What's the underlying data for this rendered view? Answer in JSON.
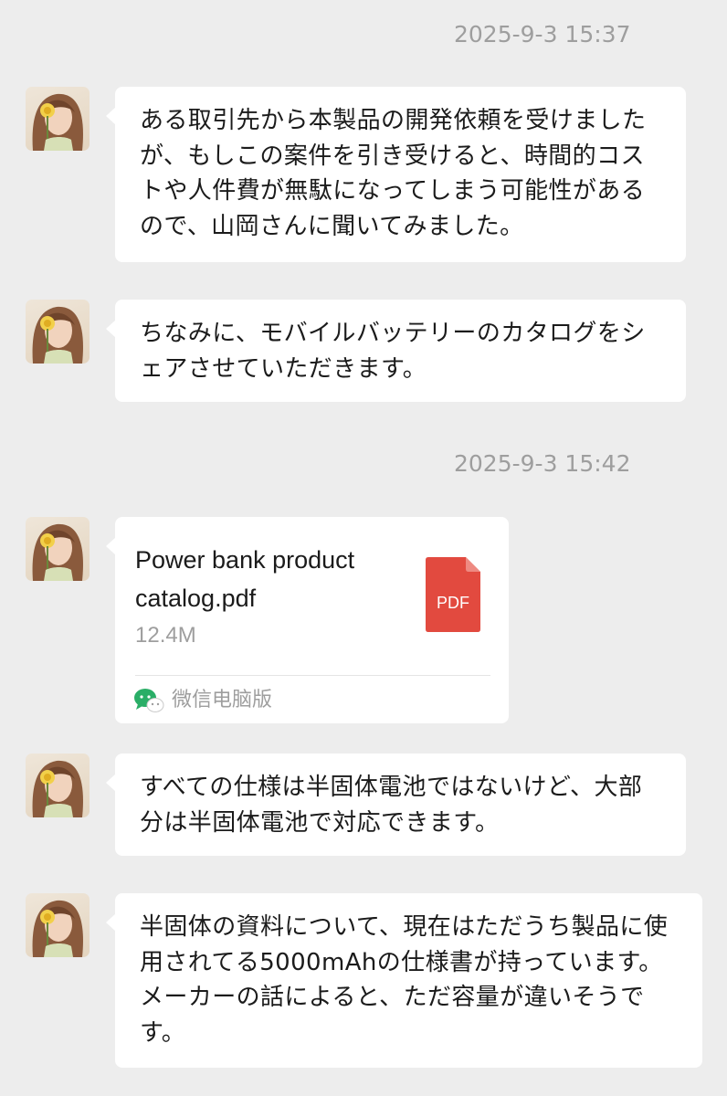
{
  "colors": {
    "background": "#ededed",
    "bubble": "#ffffff",
    "timestamp": "#9e9e9e",
    "pdf_red": "#e24a3f",
    "wechat_green": "#2aae67"
  },
  "timestamps": [
    "2025-9-3 15:37",
    "2025-9-3 15:42"
  ],
  "messages": [
    {
      "avatar": "contact-avatar",
      "text": "ある取引先から本製品の開発依頼を受けましたが、もしこの案件を引き受けると、時間的コストや人件費が無駄になってしまう可能性があるので、山岡さんに聞いてみました。"
    },
    {
      "avatar": "contact-avatar",
      "text": "ちなみに、モバイルバッテリーのカタログをシェアさせていただきます。"
    },
    {
      "avatar": "contact-avatar",
      "file": {
        "name": "Power bank product catalog.pdf",
        "size": "12.4M",
        "icon_label": "PDF",
        "icon": "pdf-file-icon",
        "source": "微信电脑版",
        "source_icon": "wechat-icon"
      }
    },
    {
      "avatar": "contact-avatar",
      "text": "すべての仕様は半固体電池ではないけど、大部分は半固体電池で対応できます。"
    },
    {
      "avatar": "contact-avatar",
      "text": "半固体の資料について、現在はただうち製品に使用されてる5000mAhの仕様書が持っています。メーカーの話によると、ただ容量が違いそうです。"
    }
  ]
}
